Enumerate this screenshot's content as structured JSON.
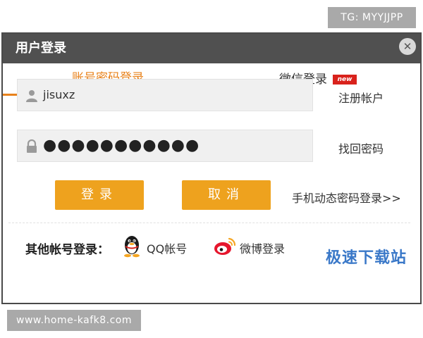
{
  "overlay": {
    "tg_text": "TG: MYYJJPP",
    "url_text": "www.home-kafk8.com",
    "watermark_brand": "极速下载站"
  },
  "dialog": {
    "title": "用户登录",
    "close_glyph": "✕",
    "tabs": {
      "account_label": "账号密码登录",
      "wechat_label": "微信登录",
      "new_badge": "new"
    },
    "username": {
      "value": "jisuxz"
    },
    "password": {
      "value": "●●●●●●●●●●●"
    },
    "register_link": "注册帐户",
    "recover_link": "找回密码",
    "login_button": "登录",
    "cancel_button": "取消",
    "sms_login_link": "手机动态密码登录>>",
    "other_login": {
      "label": "其他帐号登录：",
      "qq_label": "QQ帐号",
      "weibo_label": "微博登录"
    }
  },
  "colors": {
    "accent_orange": "#e8821b",
    "button_orange": "#eea21e",
    "titlebar": "#505050",
    "new_badge": "#d9221c",
    "brand_blue": "#3a78c8"
  },
  "icons": {
    "user": "user-icon",
    "lock": "lock-icon",
    "close": "close-icon",
    "qq": "qq-penguin-icon",
    "weibo": "weibo-icon"
  }
}
